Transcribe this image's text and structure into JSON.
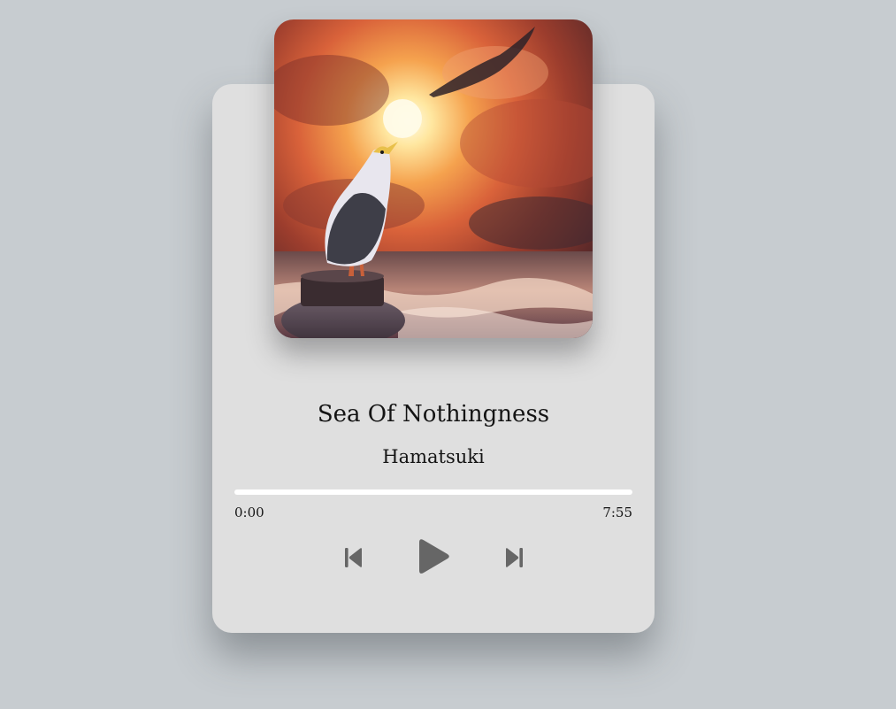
{
  "track": {
    "title": "Sea Of Nothingness",
    "artist": "Hamatsuki",
    "album_art": "painting of a seagull on a post at sea under a fiery sunset sky"
  },
  "progress": {
    "current_time": "0:00",
    "duration": "7:55",
    "fraction": 0
  },
  "controls": {
    "previous_icon": "skip-previous-icon",
    "play_icon": "play-icon",
    "next_icon": "skip-next-icon"
  },
  "colors": {
    "background": "#c7ccd0",
    "card": "#dfdfdf",
    "control_icon": "#666666",
    "progress_track": "#ffffff"
  }
}
